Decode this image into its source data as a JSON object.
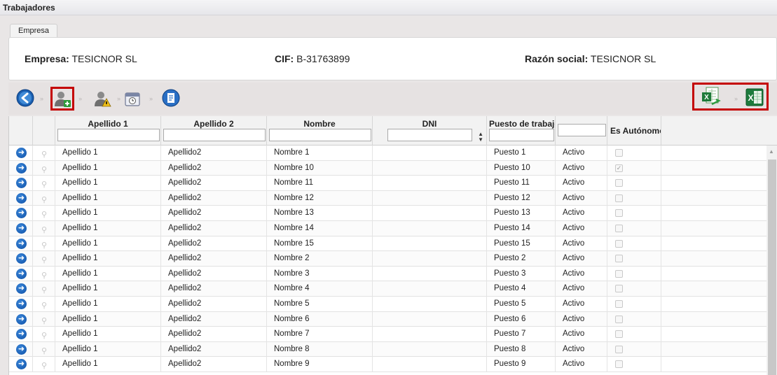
{
  "window": {
    "title": "Trabajadores"
  },
  "tabs": [
    {
      "label": "Empresa"
    }
  ],
  "company": {
    "empresa_label": "Empresa:",
    "empresa_value": "TESICNOR SL",
    "cif_label": "CIF:",
    "cif_value": "B-31763899",
    "razon_label": "Razón social:",
    "razon_value": "TESICNOR SL"
  },
  "toolbar": {
    "icons": [
      "back-icon",
      "add-worker-icon",
      "worker-warning-icon",
      "calendar-icon",
      "document-icon",
      "excel-import-icon",
      "excel-export-icon"
    ],
    "separator": "»",
    "highlight_color": "#c40000"
  },
  "grid": {
    "columns": [
      {
        "label": "Apellido 1"
      },
      {
        "label": "Apellido 2"
      },
      {
        "label": "Nombre"
      },
      {
        "label": "DNI"
      },
      {
        "label": "Puesto de trabajo"
      },
      {
        "label": ""
      },
      {
        "label": "Es Autónomo"
      }
    ],
    "rows": [
      {
        "ap1": "Apellido 1",
        "ap2": "Apellido2",
        "nombre": "Nombre 1",
        "dni": "",
        "puesto": "Puesto 1",
        "estado": "Activo",
        "autonomo": false
      },
      {
        "ap1": "Apellido 1",
        "ap2": "Apellido2",
        "nombre": "Nombre 10",
        "dni": "",
        "puesto": "Puesto 10",
        "estado": "Activo",
        "autonomo": true
      },
      {
        "ap1": "Apellido 1",
        "ap2": "Apellido2",
        "nombre": "Nombre 11",
        "dni": "",
        "puesto": "Puesto 11",
        "estado": "Activo",
        "autonomo": false
      },
      {
        "ap1": "Apellido 1",
        "ap2": "Apellido2",
        "nombre": "Nombre 12",
        "dni": "",
        "puesto": "Puesto 12",
        "estado": "Activo",
        "autonomo": false
      },
      {
        "ap1": "Apellido 1",
        "ap2": "Apellido2",
        "nombre": "Nombre 13",
        "dni": "",
        "puesto": "Puesto 13",
        "estado": "Activo",
        "autonomo": false
      },
      {
        "ap1": "Apellido 1",
        "ap2": "Apellido2",
        "nombre": "Nombre 14",
        "dni": "",
        "puesto": "Puesto 14",
        "estado": "Activo",
        "autonomo": false
      },
      {
        "ap1": "Apellido 1",
        "ap2": "Apellido2",
        "nombre": "Nombre 15",
        "dni": "",
        "puesto": "Puesto 15",
        "estado": "Activo",
        "autonomo": false
      },
      {
        "ap1": "Apellido 1",
        "ap2": "Apellido2",
        "nombre": "Nombre 2",
        "dni": "",
        "puesto": "Puesto 2",
        "estado": "Activo",
        "autonomo": false
      },
      {
        "ap1": "Apellido 1",
        "ap2": "Apellido2",
        "nombre": "Nombre 3",
        "dni": "",
        "puesto": "Puesto 3",
        "estado": "Activo",
        "autonomo": false
      },
      {
        "ap1": "Apellido 1",
        "ap2": "Apellido2",
        "nombre": "Nombre 4",
        "dni": "",
        "puesto": "Puesto 4",
        "estado": "Activo",
        "autonomo": false
      },
      {
        "ap1": "Apellido 1",
        "ap2": "Apellido2",
        "nombre": "Nombre 5",
        "dni": "",
        "puesto": "Puesto 5",
        "estado": "Activo",
        "autonomo": false
      },
      {
        "ap1": "Apellido 1",
        "ap2": "Apellido2",
        "nombre": "Nombre 6",
        "dni": "",
        "puesto": "Puesto 6",
        "estado": "Activo",
        "autonomo": false
      },
      {
        "ap1": "Apellido 1",
        "ap2": "Apellido2",
        "nombre": "Nombre 7",
        "dni": "",
        "puesto": "Puesto 7",
        "estado": "Activo",
        "autonomo": false
      },
      {
        "ap1": "Apellido 1",
        "ap2": "Apellido2",
        "nombre": "Nombre 8",
        "dni": "",
        "puesto": "Puesto 8",
        "estado": "Activo",
        "autonomo": false
      },
      {
        "ap1": "Apellido 1",
        "ap2": "Apellido2",
        "nombre": "Nombre 9",
        "dni": "",
        "puesto": "Puesto 9",
        "estado": "Activo",
        "autonomo": false
      }
    ]
  }
}
